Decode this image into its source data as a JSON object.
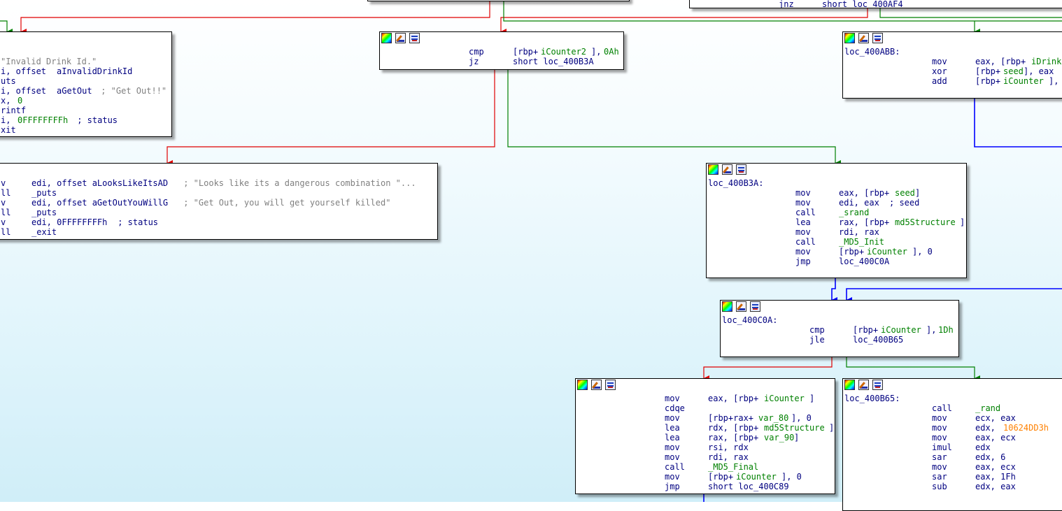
{
  "app": {
    "view": "IDA graph view"
  },
  "toolbar_icons": [
    "color-node-icon",
    "rename-node-icon",
    "graph-overview-icon"
  ],
  "colors": {
    "true_edge": "#008000",
    "false_edge": "#e00000",
    "unconditional_edge": "#0000ff",
    "mnemonic": "#000080",
    "symbol": "#008000",
    "comment": "#808080",
    "constant_hex": "#ff8000"
  },
  "nodes": {
    "top_right_partial": {
      "lines": [
        {
          "mnem": "jnz",
          "op": "short loc_400AF4"
        }
      ]
    },
    "cmp_icounter2": {
      "lines": [
        {
          "mnem": "cmp",
          "op_a": "[rbp+",
          "op_b": "iCounter2",
          "op_c": "], ",
          "op_d": "0Ah"
        },
        {
          "mnem": "jz",
          "op": "short loc_400B3A"
        }
      ]
    },
    "invalid_drink": {
      "lines": [
        {
          "text": "\"Invalid Drink Id.\""
        },
        {
          "a": "i, offset ",
          "b": "aInvalidDrinkId"
        },
        {
          "a": "uts"
        },
        {
          "a": "i, offset ",
          "b": "aGetOut",
          "c": " ; \"Get Out!!\""
        },
        {
          "a": "x, ",
          "b": "0"
        },
        {
          "a": "rintf"
        },
        {
          "a": "i, ",
          "b": "0FFFFFFFFh",
          "c": " ; status"
        },
        {
          "a": "xit"
        }
      ]
    },
    "dangerous_combo": {
      "lines": [
        {
          "m": "v",
          "o": "edi, offset aLooksLikeItsAD",
          "c": " ; \"Looks like its a dangerous combination \"..."
        },
        {
          "m": "ll",
          "o": "_puts"
        },
        {
          "m": "v",
          "o": "edi, offset aGetOutYouWillG",
          "c": " ; \"Get Out, you will get yourself killed\""
        },
        {
          "m": "ll",
          "o": "_puts"
        },
        {
          "m": "v",
          "o": "edi, 0FFFFFFFFh",
          "c": " ; status"
        },
        {
          "m": "ll",
          "o": "_exit"
        }
      ]
    },
    "loc_400ABB": {
      "label": "loc_400ABB:",
      "lines": [
        {
          "mnem": "mov",
          "op1": "eax, [rbp+",
          "op2": "iDrink"
        },
        {
          "mnem": "xor",
          "op1": "[rbp+",
          "op2": "seed",
          "op3": "], eax"
        },
        {
          "mnem": "add",
          "op1": "[rbp+",
          "op2": "iCounter",
          "op3": "],"
        }
      ]
    },
    "loc_400B3A": {
      "label": "loc_400B3A:",
      "lines": [
        {
          "mnem": "mov",
          "op1": "eax, [rbp+",
          "op2": "seed",
          "op3": "]"
        },
        {
          "mnem": "mov",
          "op1": "edi, eax ",
          "op2": "",
          "op3": "; seed"
        },
        {
          "mnem": "call",
          "op1": "_srand"
        },
        {
          "mnem": "lea",
          "op1": "rax, [rbp+",
          "op2": "md5Structure",
          "op3": "]"
        },
        {
          "mnem": "mov",
          "op1": "rdi, rax"
        },
        {
          "mnem": "call",
          "op1": "_MD5_Init"
        },
        {
          "mnem": "mov",
          "op1": "[rbp+",
          "op2": "iCounter",
          "op3": "], 0"
        },
        {
          "mnem": "jmp",
          "op1": "loc_400C0A"
        }
      ]
    },
    "loc_400C0A": {
      "label": "loc_400C0A:",
      "lines": [
        {
          "mnem": "cmp",
          "op1": "[rbp+",
          "op2": "iCounter",
          "op3": "], ",
          "op4": "1Dh"
        },
        {
          "mnem": "jle",
          "op1": "loc_400B65"
        }
      ]
    },
    "md5_final_block": {
      "lines": [
        {
          "mnem": "mov",
          "op1": "eax, [rbp+",
          "op2": "iCounter",
          "op3": "]"
        },
        {
          "mnem": "cdqe"
        },
        {
          "mnem": "mov",
          "op1": "[rbp+rax+",
          "op2": "var_80",
          "op3": "], 0"
        },
        {
          "mnem": "lea",
          "op1": "rdx, [rbp+",
          "op2": "md5Structure",
          "op3": "]"
        },
        {
          "mnem": "lea",
          "op1": "rax, [rbp+",
          "op2": "var_90",
          "op3": "]"
        },
        {
          "mnem": "mov",
          "op1": "rsi, rdx"
        },
        {
          "mnem": "mov",
          "op1": "rdi, rax"
        },
        {
          "mnem": "call",
          "op1": "_MD5_Final"
        },
        {
          "mnem": "mov",
          "op1": "[rbp+",
          "op2": "iCounter",
          "op3": "], 0"
        },
        {
          "mnem": "jmp",
          "op1": "short loc_400C89"
        }
      ]
    },
    "loc_400B65": {
      "label": "loc_400B65:",
      "lines": [
        {
          "mnem": "call",
          "op1": "_rand"
        },
        {
          "mnem": "mov",
          "op1": "ecx, eax"
        },
        {
          "mnem": "mov",
          "op1": "edx, ",
          "hex": "10624DD3h"
        },
        {
          "mnem": "mov",
          "op1": "eax, ecx"
        },
        {
          "mnem": "imul",
          "op1": "edx"
        },
        {
          "mnem": "sar",
          "op1": "edx, 6"
        },
        {
          "mnem": "mov",
          "op1": "eax, ecx"
        },
        {
          "mnem": "sar",
          "op1": "eax, 1Fh"
        },
        {
          "mnem": "sub",
          "op1": "edx, eax"
        }
      ]
    }
  }
}
